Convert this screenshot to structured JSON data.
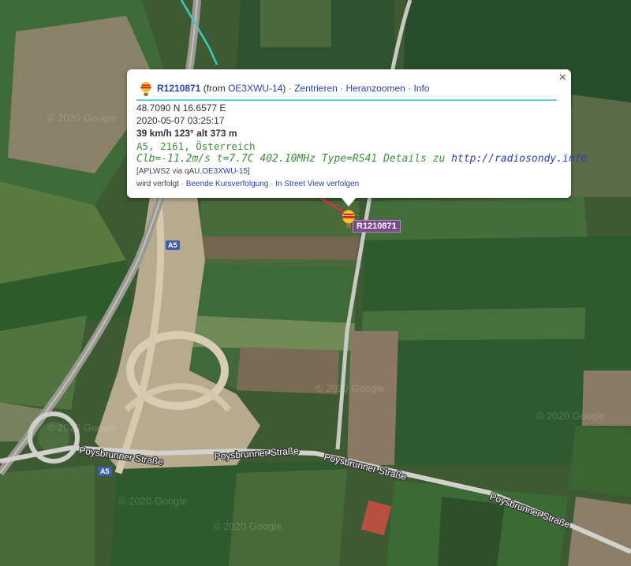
{
  "map": {
    "watermarks": [
      "© 2020 Google",
      "© 2020 Google",
      "© 2020 Google",
      "© 2020 Google",
      "© 2020 Google",
      "© 2020 Google"
    ],
    "road_labels": [
      "Poysbrunner Straße",
      "Poysbrunner Straße",
      "Poysbrunner Straße",
      "Poysbrunner Straße"
    ],
    "highway_shields": [
      "A5",
      "A5"
    ]
  },
  "marker": {
    "label": "R1210871"
  },
  "popup": {
    "close_symbol": "×",
    "callsign": "R1210871",
    "from_prefix": " (from ",
    "from_station": "OE3XWU-14",
    "from_suffix": ")",
    "actions": [
      "Zentrieren",
      "Heranzoomen",
      "Info"
    ],
    "separator": " · ",
    "coordinates": "48.7090 N 16.6577 E",
    "timestamp": "2020-05-07 03:25:17",
    "motion": "39 km/h 123° alt 373 m",
    "address": "A5, 2161, Österreich",
    "comment": "Clb=-11.2m/s t=7.7C 402.10MHz Type=RS41 Details zu ",
    "comment_link": "http://radiosondy.info",
    "path_prefix": "[APLWS2 via qAU,",
    "path_station": "OE3XWU-15",
    "path_suffix": "]",
    "tracking_text": "wird verfolgt",
    "tracking_actions": [
      "Beende Kursverfolgung",
      "In Street View verfolgen"
    ]
  },
  "colors": {
    "accent_line": "#5fd0d4",
    "link": "#2b3fb8",
    "comment_green": "#3b8f3b",
    "label_bg": "#7a4a8a"
  }
}
